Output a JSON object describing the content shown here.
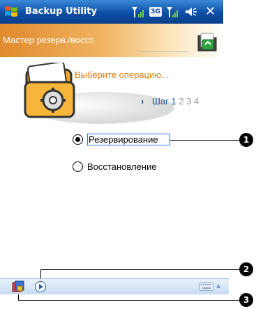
{
  "window": {
    "app_title": "Backup Utility",
    "network_badge": "3G",
    "close_label": "✕"
  },
  "wizard": {
    "header_title": "Мастер резерв./восст.",
    "prompt": "Выберите операцию...",
    "step_arrow": "›",
    "step_label": "Шаг",
    "current_step": "1",
    "other_steps": "2 3 4"
  },
  "options": [
    {
      "label": "Резервирование",
      "selected": true
    },
    {
      "label": "Восстановление",
      "selected": false
    }
  ],
  "callouts": [
    "1",
    "2",
    "3"
  ],
  "colors": {
    "title_bar": "#0d4ea6",
    "wizard_header": "#e08a2c",
    "prompt_text": "#e07b10",
    "step_text": "#1b4f9c",
    "focus_border": "#2a7ae0"
  }
}
